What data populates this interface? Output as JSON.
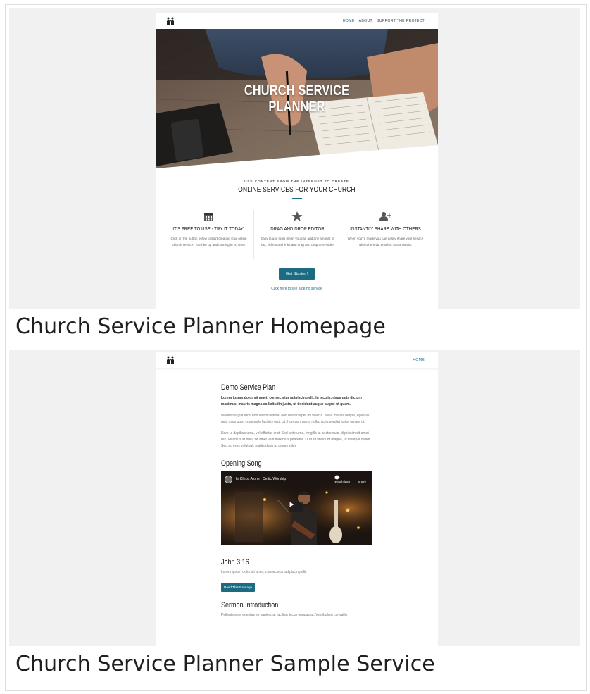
{
  "captions": {
    "homepage": "Church Service Planner Homepage",
    "sample": "Church Service Planner Sample Service"
  },
  "homepage": {
    "nav": [
      "HOME",
      "ABOUT",
      "SUPPORT THE PROJECT"
    ],
    "hero_title_line1": "CHURCH SERVICE",
    "hero_title_line2": "PLANNER",
    "kicker": "USE CONTENT FROM THE INTERNET TO CREATE",
    "subhead": "ONLINE SERVICES FOR YOUR CHURCH",
    "features": [
      {
        "icon": "calendar-icon",
        "title": "IT'S FREE TO USE - TRY IT TODAY!",
        "desc": "Click on the button below to start creating your online church service. You'll be up and running in no time!"
      },
      {
        "icon": "star-icon",
        "title": "DRAG AND DROP EDITOR",
        "desc": "Easy to use tools mean you can add any amount of text, videos and links and drag and drop to re-order."
      },
      {
        "icon": "add-user-icon",
        "title": "INSTANTLY SHARE WITH OTHERS",
        "desc": "When you're ready you can easily share your service with others via email or social media."
      }
    ],
    "cta": "Get Started!",
    "demo_link": "Click here to see a demo service"
  },
  "sample": {
    "nav": [
      "HOME"
    ],
    "title": "Demo Service Plan",
    "bold_para": "Lorem ipsum dolor sit amet, consectetur adipiscing elit. In iaculis, risus quis dictum maximus, mauris magna sollicitudin justo, ut tincidunt augue augue ut quam.",
    "para1": "Mauris feugiat arcu non lorem viverra, non ullamcorper mi viverra. Nulla mauris neque, egestas quis risus quis, commodo facilisis orci. Ut rhoncus magna nulla, ac imperdiet tortor ornare ut.",
    "para2": "Nam ut dapibus urna, vel efficitur erat. Sed ante urna, fringilla at auctor quis, dignissim sit amet dui. Vivamus at nulla sit amet velit maximus pharetra. Duis ut tincidunt magna, ut volutpat quam. Sed ac eros volutpat, mattis diam a, ornare nibh.",
    "song_heading": "Opening Song",
    "video_title": "In Christ Alone | Celtic Worship",
    "watch_later": "Watch later",
    "share": "Share",
    "passage_heading": "John 3:16",
    "passage_text": "Lorem ipsum dolor sit amet, consectetur adipiscing elit.",
    "passage_button": "Read This Passage",
    "sermon_heading": "Sermon Introduction",
    "sermon_text": "Pellentesque egestas ex sapien, at facilisis lacus tempus at. Vestibulum convallis"
  },
  "colors": {
    "accent": "#1c6b83",
    "panel_bg": "#f1f1f1"
  }
}
